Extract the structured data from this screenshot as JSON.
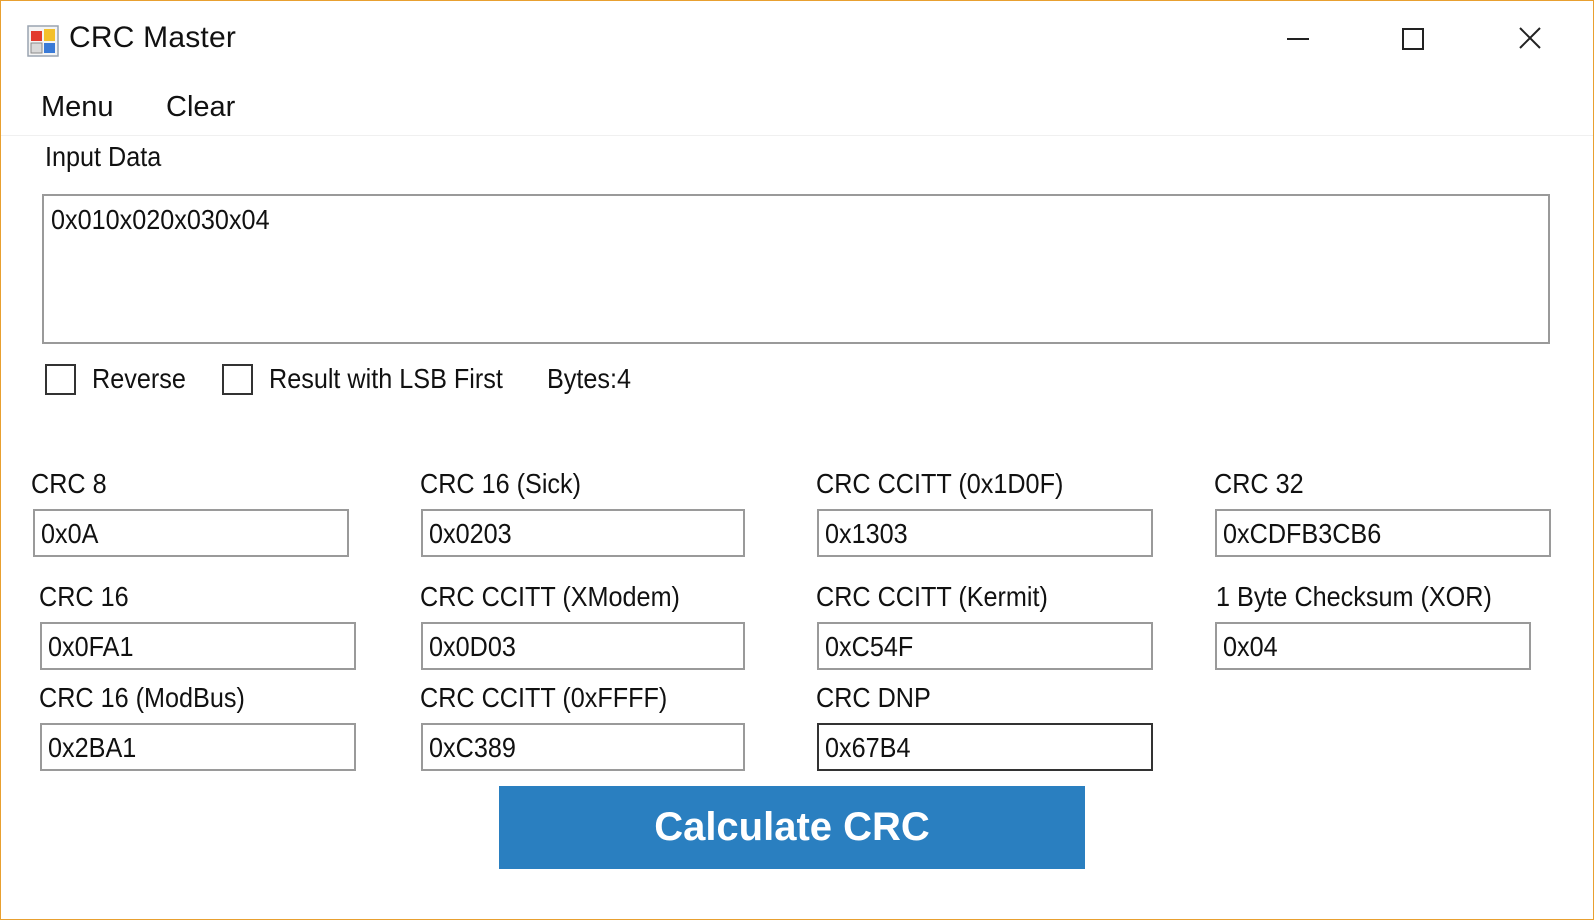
{
  "window": {
    "title": "CRC Master",
    "accent_border": "#e8a030",
    "button_color": "#2a7fc0"
  },
  "menu": {
    "items": [
      "Menu",
      "Clear"
    ]
  },
  "input": {
    "label": "Input Data",
    "value": "0x010x020x030x04"
  },
  "options": {
    "reverse_label": "Reverse",
    "reverse_checked": false,
    "lsb_label": "Result with LSB First",
    "lsb_checked": false,
    "bytes_text": "Bytes:4"
  },
  "results": {
    "crc8": {
      "label": "CRC 8",
      "value": "0x0A"
    },
    "crc16_sick": {
      "label": "CRC 16 (Sick)",
      "value": "0x0203"
    },
    "crc_ccitt_1d0f": {
      "label": "CRC  CCITT (0x1D0F)",
      "value": "0x1303"
    },
    "crc32": {
      "label": "CRC 32",
      "value": "0xCDFB3CB6"
    },
    "crc16": {
      "label": "CRC 16",
      "value": "0x0FA1"
    },
    "crc_ccitt_xmodem": {
      "label": "CRC CCITT (XModem)",
      "value": "0x0D03"
    },
    "crc_ccitt_kermit": {
      "label": "CRC CCITT (Kermit)",
      "value": "0xC54F"
    },
    "checksum_xor": {
      "label": "1 Byte Checksum (XOR)",
      "value": "0x04"
    },
    "crc16_modbus": {
      "label": "CRC 16 (ModBus)",
      "value": "0x2BA1"
    },
    "crc_ccitt_ffff": {
      "label": "CRC CCITT (0xFFFF)",
      "value": "0xC389"
    },
    "crc_dnp": {
      "label": "CRC DNP",
      "value": "0x67B4"
    }
  },
  "actions": {
    "calculate_label": "Calculate CRC"
  }
}
